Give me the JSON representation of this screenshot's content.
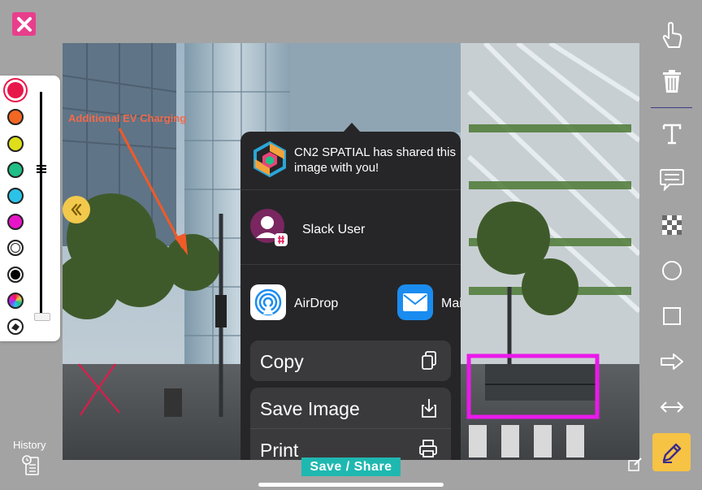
{
  "annotation": {
    "label": "Additional EV Charging"
  },
  "share_sheet": {
    "header_text": "CN2 SPATIAL has shared this image with you!",
    "contact_name": "Slack User",
    "apps": [
      {
        "label": "AirDrop",
        "icon": "airdrop-icon"
      },
      {
        "label": "Mai",
        "icon": "mail-icon"
      }
    ],
    "actions": [
      {
        "label": "Copy",
        "icon": "copy-icon"
      },
      {
        "label": "Save Image",
        "icon": "save-image-icon"
      },
      {
        "label": "Print",
        "icon": "print-icon"
      }
    ]
  },
  "palette": {
    "colors": [
      "#e8174a",
      "#f26722",
      "#dedf19",
      "#1fbf85",
      "#2bc2e8",
      "#e815c8",
      "#ffffff",
      "#000000",
      "multicolor"
    ],
    "selected": "#e8174a",
    "eraser_icon": "eraser-icon"
  },
  "toolbar": {
    "tools": [
      "hand-pointer-icon",
      "trash-icon",
      "text-icon",
      "comment-icon",
      "pattern-icon",
      "circle-icon",
      "square-icon",
      "arrow-right-icon",
      "double-arrow-icon",
      "pencil-icon"
    ],
    "active": "pencil-icon"
  },
  "footer": {
    "save_share_label": "Save / Share",
    "history_label": "History"
  },
  "colors": {
    "highlight_box": "#ea19ea",
    "annotation_red": "#e8174a",
    "accent_teal": "#1fb8b0",
    "accent_yellow": "#f6c344"
  }
}
